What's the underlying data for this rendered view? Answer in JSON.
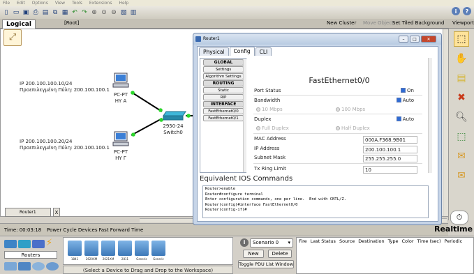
{
  "menubar": {
    "items": [
      "File",
      "Edit",
      "Options",
      "View",
      "Tools",
      "Extensions",
      "Help"
    ]
  },
  "toolbar": {
    "icons": [
      "new-icon",
      "open-icon",
      "save-icon",
      "print-icon",
      "activity-wizard-icon",
      "copy-icon",
      "paste-icon",
      "undo-icon",
      "redo-icon",
      "zoom-in-icon",
      "zoom-reset-icon",
      "zoom-out-icon",
      "palette-icon",
      "custom-device-icon"
    ]
  },
  "logicalbar": {
    "tab": "Logical",
    "root": "[Root]",
    "new_cluster": "New Cluster",
    "move_object": "Move Object",
    "set_tiled": "Set Tiled Background",
    "viewport": "Viewport"
  },
  "topology": {
    "pc_a": {
      "type": "PC-PT",
      "name": "HY A",
      "ip": "IP 200.100.100.10/24",
      "gateway": "Προεπιλεγμένη Πύλη: 200.100.100.1"
    },
    "pc_c": {
      "type": "PC-PT",
      "name": "HY Γ",
      "ip": "IP 200.100.100.20/24",
      "gateway": "Προεπιλεγμένη Πύλη: 200.100.100.1"
    },
    "switch": {
      "type": "2950-24",
      "name": "Switch0"
    }
  },
  "router_tab": {
    "label": "Router1",
    "close": "X"
  },
  "statusbar": {
    "time": "Time: 00:03:18",
    "power_cycle": "Power Cycle Devices",
    "fast_forward": "Fast Forward Time",
    "mode": "Realtime"
  },
  "bottom": {
    "category": "Routers",
    "devices": [
      "1841",
      "2620XM",
      "2621XM",
      "2811",
      "Generic",
      "Generic"
    ],
    "hint": "(Select a Device to Drag and Drop to the Workspace)",
    "scenario": "Scenario 0",
    "new": "New",
    "delete": "Delete",
    "toggle_pdu": "Toggle PDU List Window",
    "pdu_columns": [
      "Fire",
      "Last Status",
      "Source",
      "Destination",
      "Type",
      "Color",
      "Time (sec)",
      "Periodic"
    ]
  },
  "router_window": {
    "title": "Router1",
    "tabs": [
      "Physical",
      "Config",
      "CLI"
    ],
    "active_tab": "Config",
    "nav": [
      {
        "label": "GLOBAL",
        "header": true
      },
      {
        "label": "Settings"
      },
      {
        "label": "Algorithm Settings"
      },
      {
        "label": "ROUTING",
        "header": true
      },
      {
        "label": "Static"
      },
      {
        "label": "RIP"
      },
      {
        "label": "INTERFACE",
        "header": true
      },
      {
        "label": "FastEthernet0/0"
      },
      {
        "label": "FastEthernet0/1"
      }
    ],
    "config": {
      "interface_title": "FastEthernet0/0",
      "port_status_label": "Port Status",
      "port_status_value": "On",
      "bandwidth_label": "Bandwidth",
      "bandwidth_auto": "Auto",
      "bw_10": "10 Mbps",
      "bw_100": "100 Mbps",
      "duplex_label": "Duplex",
      "duplex_auto": "Auto",
      "full_duplex": "Full Duplex",
      "half_duplex": "Half Duplex",
      "mac_label": "MAC Address",
      "mac_value": "000A.F368.9B01",
      "ip_label": "IP Address",
      "ip_value": "200.100.100.1",
      "mask_label": "Subnet Mask",
      "mask_value": "255.255.255.0",
      "tx_label": "Tx Ring Limit",
      "tx_value": "10"
    },
    "ios_title": "Equivalent IOS Commands",
    "ios_lines": [
      "Router>enable",
      "Router#configure terminal",
      "Enter configuration commands, one per line.  End with CNTL/Z.",
      "Router(config)#interface FastEthernet0/0",
      "Router(config-if)#"
    ]
  }
}
